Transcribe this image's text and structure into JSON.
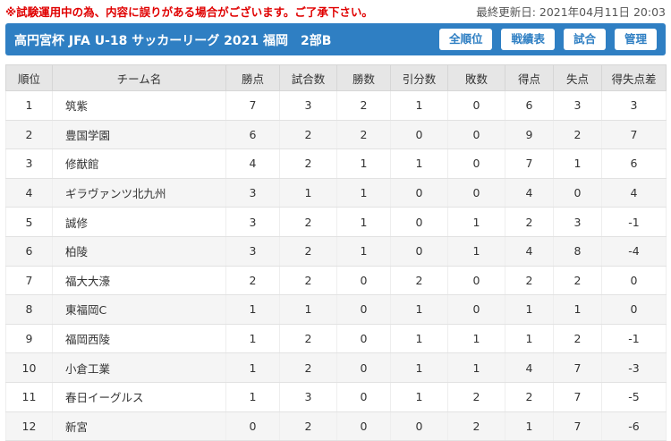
{
  "notice": "※試験運用中の為、内容に誤りがある場合がございます。ご了承下さい。",
  "last_updated": "最終更新日: 2021年04月11日 20:03",
  "header": {
    "title": "高円宮杯 JFA U-18 サッカーリーグ 2021 福岡　2部B",
    "nav": [
      "全順位",
      "戦績表",
      "試合",
      "管理"
    ]
  },
  "colors": {
    "header_bg": "#2f7fc3",
    "notice": "#e00000"
  },
  "table": {
    "columns": [
      "順位",
      "チーム名",
      "勝点",
      "試合数",
      "勝数",
      "引分数",
      "敗数",
      "得点",
      "失点",
      "得失点差"
    ],
    "rows": [
      [
        "1",
        "筑紫",
        "7",
        "3",
        "2",
        "1",
        "0",
        "6",
        "3",
        "3"
      ],
      [
        "2",
        "豊国学園",
        "6",
        "2",
        "2",
        "0",
        "0",
        "9",
        "2",
        "7"
      ],
      [
        "3",
        "修猷館",
        "4",
        "2",
        "1",
        "1",
        "0",
        "7",
        "1",
        "6"
      ],
      [
        "4",
        "ギラヴァンツ北九州",
        "3",
        "1",
        "1",
        "0",
        "0",
        "4",
        "0",
        "4"
      ],
      [
        "5",
        "誠修",
        "3",
        "2",
        "1",
        "0",
        "1",
        "2",
        "3",
        "-1"
      ],
      [
        "6",
        "柏陵",
        "3",
        "2",
        "1",
        "0",
        "1",
        "4",
        "8",
        "-4"
      ],
      [
        "7",
        "福大大濠",
        "2",
        "2",
        "0",
        "2",
        "0",
        "2",
        "2",
        "0"
      ],
      [
        "8",
        "東福岡C",
        "1",
        "1",
        "0",
        "1",
        "0",
        "1",
        "1",
        "0"
      ],
      [
        "9",
        "福岡西陵",
        "1",
        "2",
        "0",
        "1",
        "1",
        "1",
        "2",
        "-1"
      ],
      [
        "10",
        "小倉工業",
        "1",
        "2",
        "0",
        "1",
        "1",
        "4",
        "7",
        "-3"
      ],
      [
        "11",
        "春日イーグルス",
        "1",
        "3",
        "0",
        "1",
        "2",
        "2",
        "7",
        "-5"
      ],
      [
        "12",
        "新宮",
        "0",
        "2",
        "0",
        "0",
        "2",
        "1",
        "7",
        "-6"
      ]
    ]
  }
}
